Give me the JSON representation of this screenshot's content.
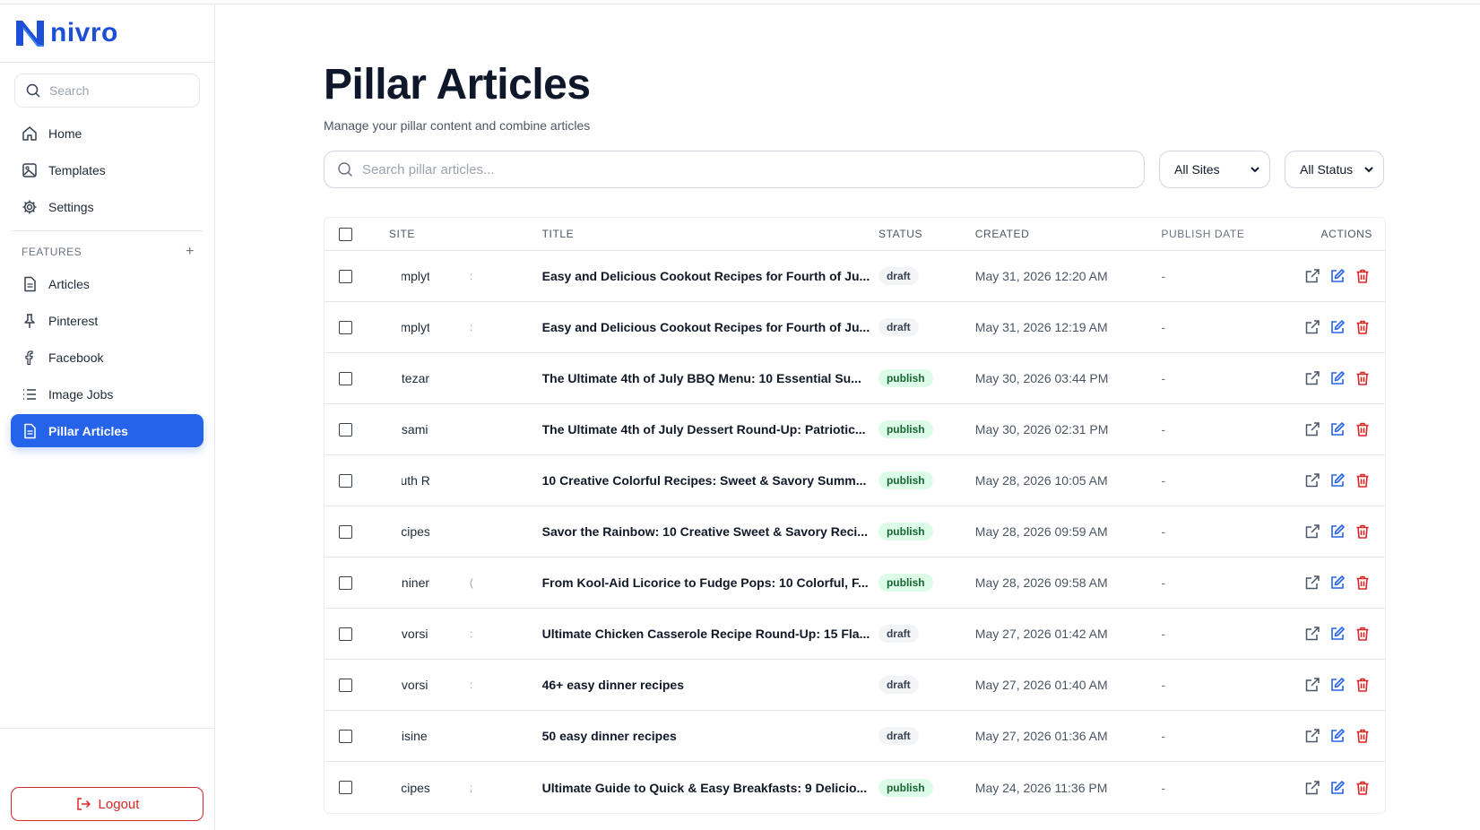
{
  "brand": {
    "logo_letter": "N",
    "name": "nivro"
  },
  "sidebar": {
    "search_placeholder": "Search",
    "nav": [
      {
        "label": "Home",
        "icon": "home-icon"
      },
      {
        "label": "Templates",
        "icon": "image-icon"
      },
      {
        "label": "Settings",
        "icon": "gear-icon"
      }
    ],
    "features_label": "FEATURES",
    "features_add": "+",
    "features": [
      {
        "label": "Articles",
        "icon": "document-icon"
      },
      {
        "label": "Pinterest",
        "icon": "pin-icon"
      },
      {
        "label": "Facebook",
        "icon": "facebook-icon"
      },
      {
        "label": "Image Jobs",
        "icon": "list-icon"
      },
      {
        "label": "Pillar Articles",
        "icon": "document-icon",
        "active": true
      }
    ],
    "logout_label": "Logout"
  },
  "page": {
    "title": "Pillar Articles",
    "subtitle": "Manage your pillar content and combine articles",
    "search_placeholder": "Search pillar articles...",
    "site_filter": "All Sites",
    "status_filter": "All Status"
  },
  "table": {
    "headers": {
      "site": "SITE",
      "title": "TITLE",
      "status": "STATUS",
      "created": "CREATED",
      "publish_date": "PUBLISH DATE",
      "actions": "ACTIONS"
    },
    "rows": [
      {
        "site": "mplyt",
        "mark": ":",
        "title": "Easy and Delicious Cookout Recipes for Fourth of Ju...",
        "status": "draft",
        "created": "May 31, 2026 12:20 AM",
        "publish_date": "-"
      },
      {
        "site": "mplyt",
        "mark": ":",
        "title": "Easy and Delicious Cookout Recipes for Fourth of Ju...",
        "status": "draft",
        "created": "May 31, 2026 12:19 AM",
        "publish_date": "-"
      },
      {
        "site": "tezar",
        "mark": "",
        "title": "The Ultimate 4th of July BBQ Menu: 10 Essential Su...",
        "status": "publish",
        "created": "May 30, 2026 03:44 PM",
        "publish_date": "-"
      },
      {
        "site": "sami",
        "mark": "",
        "title": "The Ultimate 4th of July Dessert Round-Up: Patriotic...",
        "status": "publish",
        "created": "May 30, 2026 02:31 PM",
        "publish_date": "-"
      },
      {
        "site": "uth R",
        "mark": "",
        "title": "10 Creative Colorful Recipes: Sweet & Savory Summ...",
        "status": "publish",
        "created": "May 28, 2026 10:05 AM",
        "publish_date": "-"
      },
      {
        "site": "cipes",
        "mark": "",
        "title": "Savor the Rainbow: 10 Creative Sweet & Savory Reci...",
        "status": "publish",
        "created": "May 28, 2026 09:59 AM",
        "publish_date": "-"
      },
      {
        "site": "niner",
        "mark": "(",
        "title": "From Kool-Aid Licorice to Fudge Pops: 10 Colorful, F...",
        "status": "publish",
        "created": "May 28, 2026 09:58 AM",
        "publish_date": "-"
      },
      {
        "site": "vorsi",
        "mark": ":",
        "title": "Ultimate Chicken Casserole Recipe Round-Up: 15 Fla...",
        "status": "draft",
        "created": "May 27, 2026 01:42 AM",
        "publish_date": "-"
      },
      {
        "site": "vorsi",
        "mark": ":",
        "title": "46+ easy dinner recipes",
        "status": "draft",
        "created": "May 27, 2026 01:40 AM",
        "publish_date": "-"
      },
      {
        "site": "isine",
        "mark": "",
        "title": "50 easy dinner recipes",
        "status": "draft",
        "created": "May 27, 2026 01:36 AM",
        "publish_date": "-"
      },
      {
        "site": "cipes",
        "mark": ";",
        "title": "Ultimate Guide to Quick & Easy Breakfasts: 9 Delicio...",
        "status": "publish",
        "created": "May 24, 2026 11:36 PM",
        "publish_date": "-"
      }
    ]
  },
  "colors": {
    "accent": "#2563eb",
    "danger": "#dc2626",
    "publish_bg": "#dcfce7",
    "draft_bg": "#f3f4f6"
  }
}
